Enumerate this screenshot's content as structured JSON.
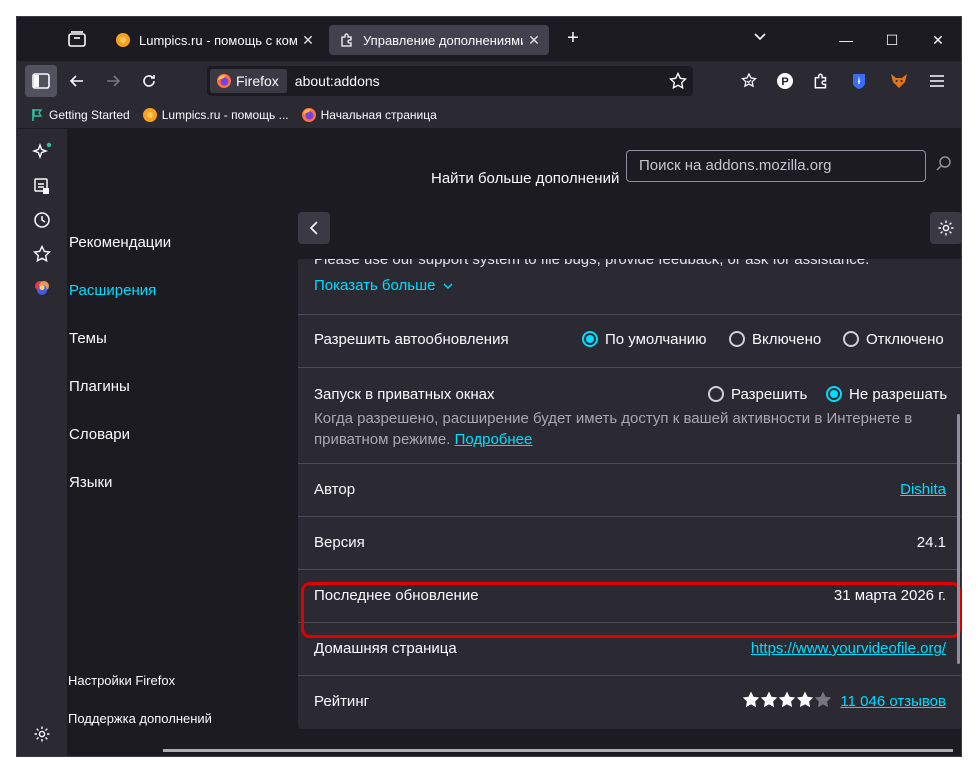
{
  "tabs": [
    {
      "title": "Lumpics.ru - помощь с компь",
      "favicon": "orange-circle-icon"
    },
    {
      "title": "Управление дополнениями",
      "favicon": "puzzle-icon",
      "active": true
    }
  ],
  "toolbar": {
    "identity_label": "Firefox",
    "url": "about:addons"
  },
  "bookmarks": [
    {
      "label": "Getting Started",
      "icon": "getting-started-icon"
    },
    {
      "label": "Lumpics.ru - помощь ...",
      "icon": "orange-circle-icon"
    },
    {
      "label": "Начальная страница",
      "icon": "firefox-icon"
    }
  ],
  "header": {
    "find_label": "Найти больше дополнений",
    "search_placeholder": "Поиск на addons.mozilla.org"
  },
  "categories": [
    {
      "label": "Рекомендации",
      "active": false
    },
    {
      "label": "Расширения",
      "active": true
    },
    {
      "label": "Темы",
      "active": false
    },
    {
      "label": "Плагины",
      "active": false
    },
    {
      "label": "Словари",
      "active": false
    },
    {
      "label": "Языки",
      "active": false
    }
  ],
  "footer_links": {
    "settings": "Настройки Firefox",
    "support": "Поддержка дополнений"
  },
  "details": {
    "description_tail": "Please use our support system to file bugs, provide feedback, or ask for assistance.",
    "show_more": "Показать больше",
    "autoupdate": {
      "label": "Разрешить автообновления",
      "options": [
        "По умолчанию",
        "Включено",
        "Отключено"
      ],
      "selected": "По умолчанию"
    },
    "private": {
      "label": "Запуск в приватных окнах",
      "options": [
        "Разрешить",
        "Не разрешать"
      ],
      "selected": "Не разрешать",
      "note": "Когда разрешено, расширение будет иметь доступ к вашей активности в Интернете в",
      "note2": "приватном режиме.",
      "learn_more": "Подробнее"
    },
    "author": {
      "label": "Автор",
      "value": "Dishita"
    },
    "version": {
      "label": "Версия",
      "value": "24.1"
    },
    "updated": {
      "label": "Последнее обновление",
      "value": "31 марта 2026 г."
    },
    "homepage": {
      "label": "Домашняя страница",
      "value": "https://www.yourvideofile.org/"
    },
    "rating": {
      "label": "Рейтинг",
      "stars": 4,
      "max": 5,
      "reviews": "11 046 отзывов"
    }
  },
  "colors": {
    "accent": "#00ddff",
    "highlight": "#e00000",
    "background": "#1c1b22"
  }
}
